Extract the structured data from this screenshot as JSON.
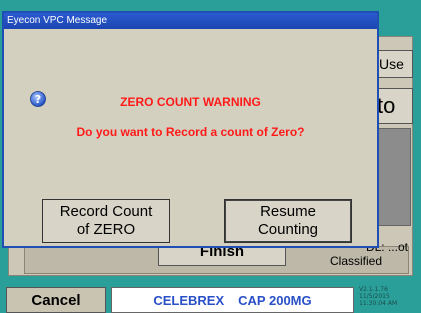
{
  "background": {
    "use_label": "Use",
    "to_label": "to",
    "finish_label": "Finish",
    "classification_line1": "DL: ...ot",
    "classification_line2": "Classified"
  },
  "dialog": {
    "title": "Eyecon VPC Message",
    "icon": "question-icon",
    "heading": "ZERO COUNT WARNING",
    "question": "Do you want to Record a count of Zero?",
    "record_button": {
      "line1": "Record Count",
      "line2": "of ZERO"
    },
    "resume_button": {
      "line1": "Resume",
      "line2": "Counting"
    }
  },
  "footer": {
    "cancel_label": "Cancel",
    "drug_name": "CELEBREX",
    "drug_strength": "CAP 200MG",
    "version": "V2.1.1.76",
    "date": "11/5/2015",
    "time": "11:30:04 AM"
  },
  "colors": {
    "background_teal": "#2a9f9a",
    "dialog_border": "#1f4fb5",
    "warning_text": "#ff1a1a",
    "product_text": "#2a50c8"
  }
}
